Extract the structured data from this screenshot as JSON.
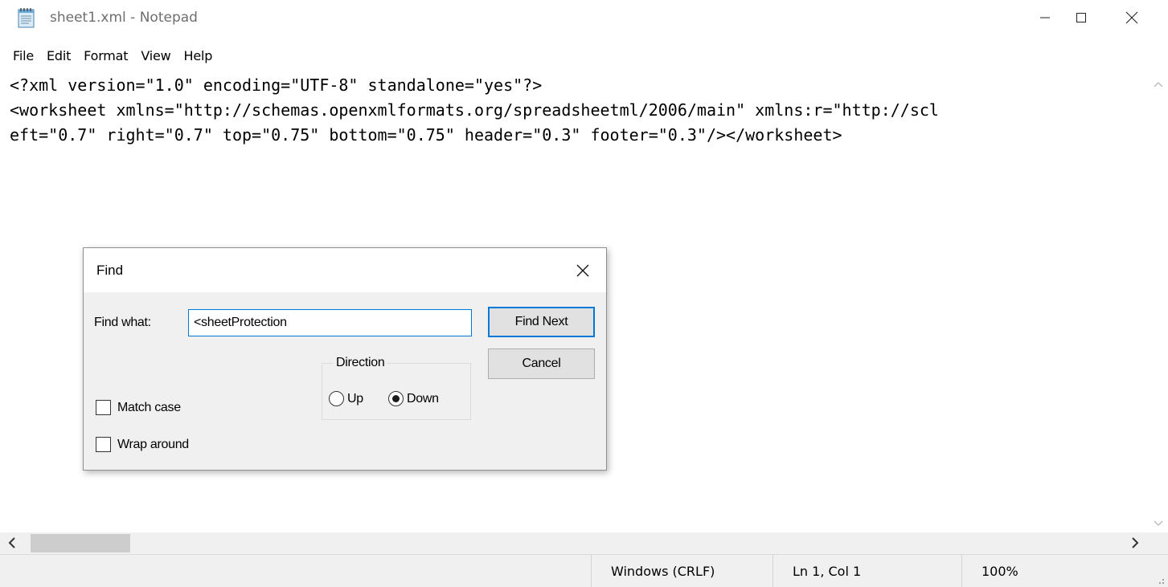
{
  "window": {
    "title": "sheet1.xml - Notepad",
    "icon": "notepad-icon"
  },
  "menu": {
    "items": [
      "File",
      "Edit",
      "Format",
      "View",
      "Help"
    ]
  },
  "editor": {
    "lines": [
      "<?xml version=\"1.0\" encoding=\"UTF-8\" standalone=\"yes\"?>",
      "<worksheet xmlns=\"http://schemas.openxmlformats.org/spreadsheetml/2006/main\" xmlns:r=\"http://scl",
      "eft=\"0.7\" right=\"0.7\" top=\"0.75\" bottom=\"0.75\" header=\"0.3\" footer=\"0.3\"/></worksheet>"
    ]
  },
  "status": {
    "line_ending": "Windows (CRLF)",
    "position": "Ln 1, Col 1",
    "zoom": "100%"
  },
  "find_dialog": {
    "title": "Find",
    "find_what_label": "Find what:",
    "find_what_value": "<sheetProtection",
    "find_next_label": "Find Next",
    "cancel_label": "Cancel",
    "direction_label": "Direction",
    "up_label": "Up",
    "down_label": "Down",
    "direction_selected": "Down",
    "match_case_label": "Match case",
    "match_case_checked": false,
    "wrap_around_label": "Wrap around",
    "wrap_around_checked": false
  }
}
